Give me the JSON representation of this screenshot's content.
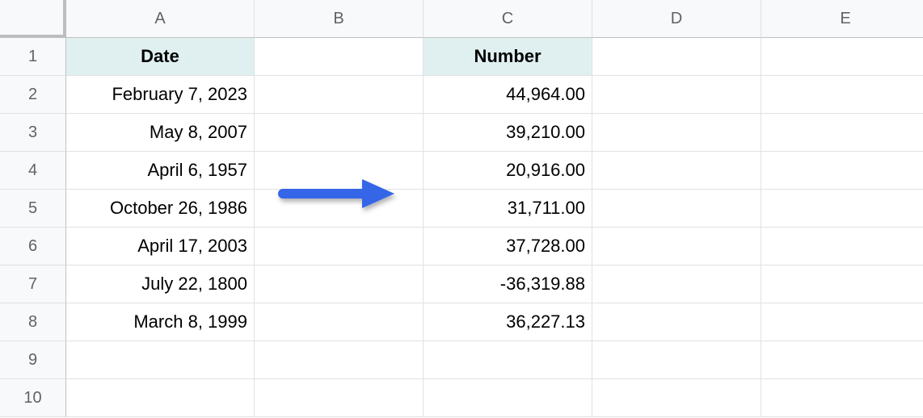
{
  "columns": [
    "A",
    "B",
    "C",
    "D",
    "E"
  ],
  "rows": [
    "1",
    "2",
    "3",
    "4",
    "5",
    "6",
    "7",
    "8",
    "9",
    "10"
  ],
  "headers": {
    "A1": "Date",
    "C1": "Number"
  },
  "data": {
    "A2": "February 7, 2023",
    "A3": "May 8, 2007",
    "A4": "April 6, 1957",
    "A5": "October 26, 1986",
    "A6": "April 17, 2003",
    "A7": "July 22, 1800",
    "A8": "March 8, 1999",
    "C2": "44,964.00",
    "C3": "39,210.00",
    "C4": "20,916.00",
    "C5": "31,711.00",
    "C6": "37,728.00",
    "C7": "-36,319.88",
    "C8": "36,227.13"
  },
  "annotation": {
    "arrow_color": "#3566e8"
  }
}
